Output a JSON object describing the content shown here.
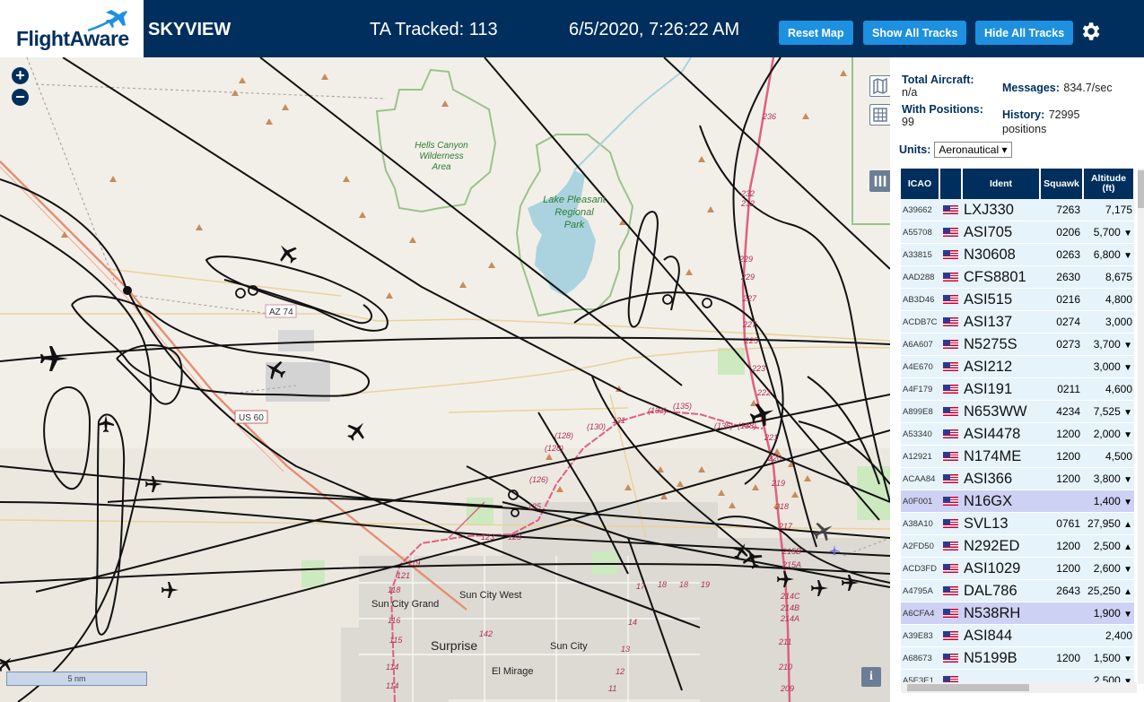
{
  "header": {
    "logo_text": "FlightAware",
    "title": "SKYVIEW",
    "tracked": "TA Tracked: 113",
    "datetime": "6/5/2020, 7:26:22 AM",
    "buttons": {
      "reset": "Reset Map",
      "show_all": "Show All Tracks",
      "hide_all": "Hide All Tracks"
    },
    "settings_icon": "gear-icon"
  },
  "map": {
    "zoom_in": "+",
    "zoom_out": "−",
    "scale": "5 nm",
    "info": "i",
    "labels": {
      "hells_canyon": [
        "Hells Canyon",
        "Wilderness",
        "Area"
      ],
      "lake_pleasant": [
        "Lake Pleasant",
        "Regional",
        "Park"
      ],
      "sun_city_grand": "Sun City Grand",
      "sun_city_west": "Sun City West",
      "sun_city": "Sun City",
      "surprise": "Surprise",
      "el_mirage": "El Mirage",
      "us60": "US 60",
      "az74": "AZ 74",
      "r236": "236",
      "r232a": "232",
      "r232b": "232",
      "r229a": "229",
      "r229b": "229",
      "r227a": "227",
      "r227b": "227",
      "r225": "225",
      "r223": "223",
      "r222": "222",
      "r221": "221",
      "r220": "220",
      "r219": "219",
      "r218": "218",
      "r217": "217",
      "r215b": "215B",
      "r215a": "215A",
      "r214c": "214C",
      "r214b": "214B",
      "r214a": "214A",
      "r211": "211",
      "r210": "210",
      "r209": "209",
      "r128a": "(128)",
      "r128b": "(128)",
      "r130": "(130)",
      "r131": "131",
      "r133": "(133)",
      "r135": "(135)",
      "r136": "(136)",
      "r138": "(138)",
      "r126": "(126)",
      "r125": "125",
      "r123": "123",
      "r123b": "123",
      "r121": "121",
      "r119": "119",
      "r118": "118",
      "r117": "117",
      "r116": "116",
      "r115": "115",
      "r114a": "114",
      "r114b": "114",
      "r113": "113",
      "r142": "142",
      "r17": "17",
      "r18a": "18",
      "r18b": "18",
      "r19": "19",
      "r14": "14",
      "r13": "13",
      "r12": "12",
      "r11": "11"
    }
  },
  "panel": {
    "total_aircraft_label": "Total Aircraft:",
    "total_aircraft_value": "n/a",
    "with_positions_label": "With Positions:",
    "with_positions_value": "99",
    "messages_label": "Messages:",
    "messages_value": "834.7/sec",
    "history_label": "History:",
    "history_value": "72995",
    "history_unit": "positions",
    "units_label": "Units:",
    "units_value": "Aeronautical",
    "columns": [
      "ICAO",
      "",
      "Ident",
      "Squawk",
      "Altitude (ft)"
    ],
    "rows": [
      {
        "icao": "A39662",
        "ident": "LXJ330",
        "squawk": "7263",
        "alt": "7,175",
        "arrow": ""
      },
      {
        "icao": "A55708",
        "ident": "ASI705",
        "squawk": "0206",
        "alt": "5,700",
        "arrow": "▼"
      },
      {
        "icao": "A33815",
        "ident": "N30608",
        "squawk": "0263",
        "alt": "6,800",
        "arrow": "▼"
      },
      {
        "icao": "AAD288",
        "ident": "CFS8801",
        "squawk": "2630",
        "alt": "8,675",
        "arrow": ""
      },
      {
        "icao": "AB3D46",
        "ident": "ASI515",
        "squawk": "0216",
        "alt": "4,800",
        "arrow": ""
      },
      {
        "icao": "ACDB7C",
        "ident": "ASI137",
        "squawk": "0274",
        "alt": "3,000",
        "arrow": ""
      },
      {
        "icao": "A6A607",
        "ident": "N5275S",
        "squawk": "0273",
        "alt": "3,700",
        "arrow": "▼"
      },
      {
        "icao": "A4E670",
        "ident": "ASI212",
        "squawk": "",
        "alt": "3,000",
        "arrow": "▼"
      },
      {
        "icao": "A4F179",
        "ident": "ASI191",
        "squawk": "0211",
        "alt": "4,600",
        "arrow": ""
      },
      {
        "icao": "A899E8",
        "ident": "N653WW",
        "squawk": "4234",
        "alt": "7,525",
        "arrow": "▼"
      },
      {
        "icao": "A53340",
        "ident": "ASI4478",
        "squawk": "1200",
        "alt": "2,000",
        "arrow": "▼"
      },
      {
        "icao": "A12921",
        "ident": "N174ME",
        "squawk": "1200",
        "alt": "4,500",
        "arrow": ""
      },
      {
        "icao": "ACAA84",
        "ident": "ASI366",
        "squawk": "1200",
        "alt": "3,800",
        "arrow": "▼"
      },
      {
        "icao": "A0F001",
        "ident": "N16GX",
        "squawk": "",
        "alt": "1,400",
        "arrow": "▼",
        "selected": true
      },
      {
        "icao": "A38A10",
        "ident": "SVL13",
        "squawk": "0761",
        "alt": "27,950",
        "arrow": "▲"
      },
      {
        "icao": "A2FD50",
        "ident": "N292ED",
        "squawk": "1200",
        "alt": "2,500",
        "arrow": "▲"
      },
      {
        "icao": "ACD3FD",
        "ident": "ASI1029",
        "squawk": "1200",
        "alt": "2,600",
        "arrow": "▼"
      },
      {
        "icao": "A4795A",
        "ident": "DAL786",
        "squawk": "2643",
        "alt": "25,250",
        "arrow": "▲"
      },
      {
        "icao": "A6CFA4",
        "ident": "N538RH",
        "squawk": "",
        "alt": "1,900",
        "arrow": "▼",
        "selected": true
      },
      {
        "icao": "A39E83",
        "ident": "ASI844",
        "squawk": "",
        "alt": "2,400",
        "arrow": ""
      },
      {
        "icao": "A68673",
        "ident": "N5199B",
        "squawk": "1200",
        "alt": "1,500",
        "arrow": "▼"
      },
      {
        "icao": "A5E3E1",
        "ident": "",
        "squawk": "",
        "alt": "2,500",
        "arrow": "▼"
      }
    ]
  },
  "colors": {
    "header": "#002f5d",
    "button": "#1e90e0",
    "row": "#e6f3fb",
    "row_selected": "#cdd1f3",
    "track": "#111111",
    "park": "#cde9c0",
    "water": "#aad3df",
    "route": "#e0607e"
  }
}
